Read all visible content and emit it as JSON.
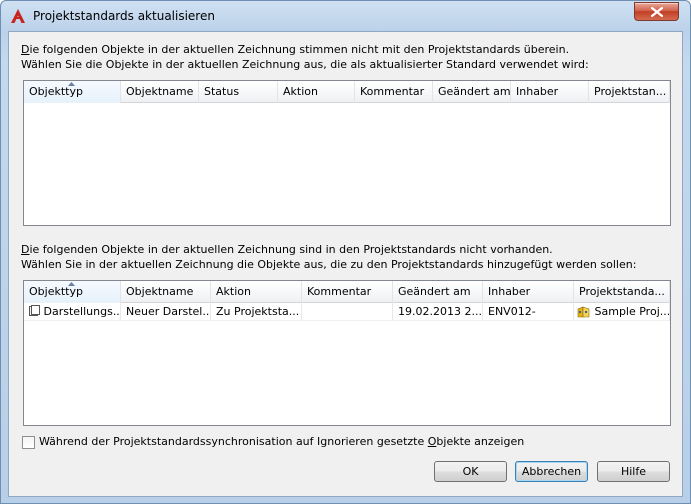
{
  "window": {
    "title": "Projektstandards aktualisieren",
    "close_icon": "close-icon",
    "app_icon": "autocad-icon"
  },
  "section1": {
    "line1_u": "D",
    "line1": "ie folgenden Objekte in der aktuellen Zeichnung stimmen nicht mit den Projektstandards überein.",
    "line2": "Wählen Sie die Objekte in der aktuellen Zeichnung aus, die als aktualisierter Standard verwendet wird:",
    "columns": [
      "Objekttyp",
      "Objektname",
      "Status",
      "Aktion",
      "Kommentar",
      "Geändert am",
      "Inhaber",
      "Projektstan..."
    ],
    "rows": []
  },
  "section2": {
    "line1_u": "D",
    "line1": "ie folgenden Objekte in der aktuellen Zeichnung sind in den Projektstandards nicht vorhanden.",
    "line2": "Wählen Sie in der aktuellen Zeichnung die Objekte aus, die zu den Projektstandards hinzugefügt werden sollen:",
    "columns": [
      "Objekttyp",
      "Objektname",
      "Aktion",
      "Kommentar",
      "Geändert am",
      "Inhaber",
      "Projektstanda..."
    ],
    "rows": [
      [
        "Darstellungs...",
        "Neuer Darstel...",
        "Zu Projektsta...",
        "",
        "19.02.2013 2...",
        "ENV012-",
        "Sample Proj..."
      ]
    ]
  },
  "checkbox": {
    "label_pre": "Während der Projektstandardssynchronisation auf Ignorieren gesetzte ",
    "label_u": "O",
    "label_post": "bjekte anzeigen",
    "checked": false
  },
  "buttons": {
    "ok": "OK",
    "cancel": "Abbrechen",
    "help": "Hilfe"
  }
}
